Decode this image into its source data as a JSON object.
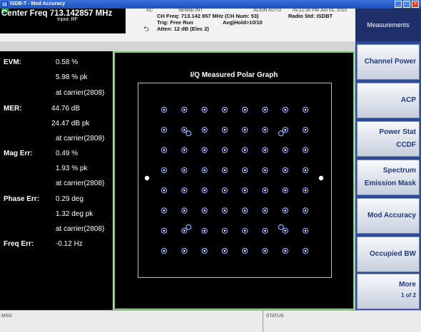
{
  "window": {
    "title": "ISDB-T - Mod Accuracy"
  },
  "header": {
    "center_freq_label": "Center Freq",
    "center_freq_value": "713.142857 MHz",
    "input": "Input: RF",
    "freq_hint": "50 Ω",
    "ac": "AC",
    "sense": "SENSE:INT",
    "align": "ALIGN AUTO",
    "datetime": "05:12:30 PM Jun 01, 2010",
    "ch_freq": "CH Freq: 713.142 857 MHz (CH Num: 53)",
    "trig": "Trig: Free Run",
    "avg": "Avg|Hold>10/10",
    "atten": "Atten: 12 dB (Elec 2)",
    "radio_std": "Radio Std: ISDBT"
  },
  "measurements": {
    "evm_label": "EVM:",
    "evm_value": "0.58 %",
    "evm_pk": "5.98 % pk",
    "evm_carrier": "at carrier(2808)",
    "mer_label": "MER:",
    "mer_value": "44.76 dB",
    "mer_pk": "24.47 dB pk",
    "mer_carrier": "at carrier(2808)",
    "mag_label": "Mag Err:",
    "mag_value": "0.49 %",
    "mag_pk": "1.93 % pk",
    "mag_carrier": "at carrier(2808)",
    "phase_label": "Phase Err:",
    "phase_value": "0.29 deg",
    "phase_pk": "1.32 deg pk",
    "phase_carrier": "at carrier(2808)",
    "freq_label": "Freq Err:",
    "freq_value": "-0.12 Hz"
  },
  "graph": {
    "title": "I/Q Measured Polar Graph",
    "constellation_size": 8,
    "pilot_points": 2
  },
  "softkeys": {
    "header": "Measurements",
    "keys": [
      {
        "line1": "Channel Power",
        "line2": ""
      },
      {
        "line1": "ACP",
        "line2": ""
      },
      {
        "line1": "Power Stat",
        "line2": "CCDF"
      },
      {
        "line1": "Spectrum",
        "line2": "Emission Mask"
      },
      {
        "line1": "Mod Accuracy",
        "line2": ""
      },
      {
        "line1": "Occupied BW",
        "line2": ""
      },
      {
        "line1": "More",
        "line2": "1 of 2"
      }
    ]
  },
  "status": {
    "msg_label": "MSG",
    "status_label": "STATUS"
  },
  "colors": {
    "accent_green": "#7ed07e",
    "softkey_text": "#1f3b7a",
    "title_bar": "#2a5bd0"
  }
}
